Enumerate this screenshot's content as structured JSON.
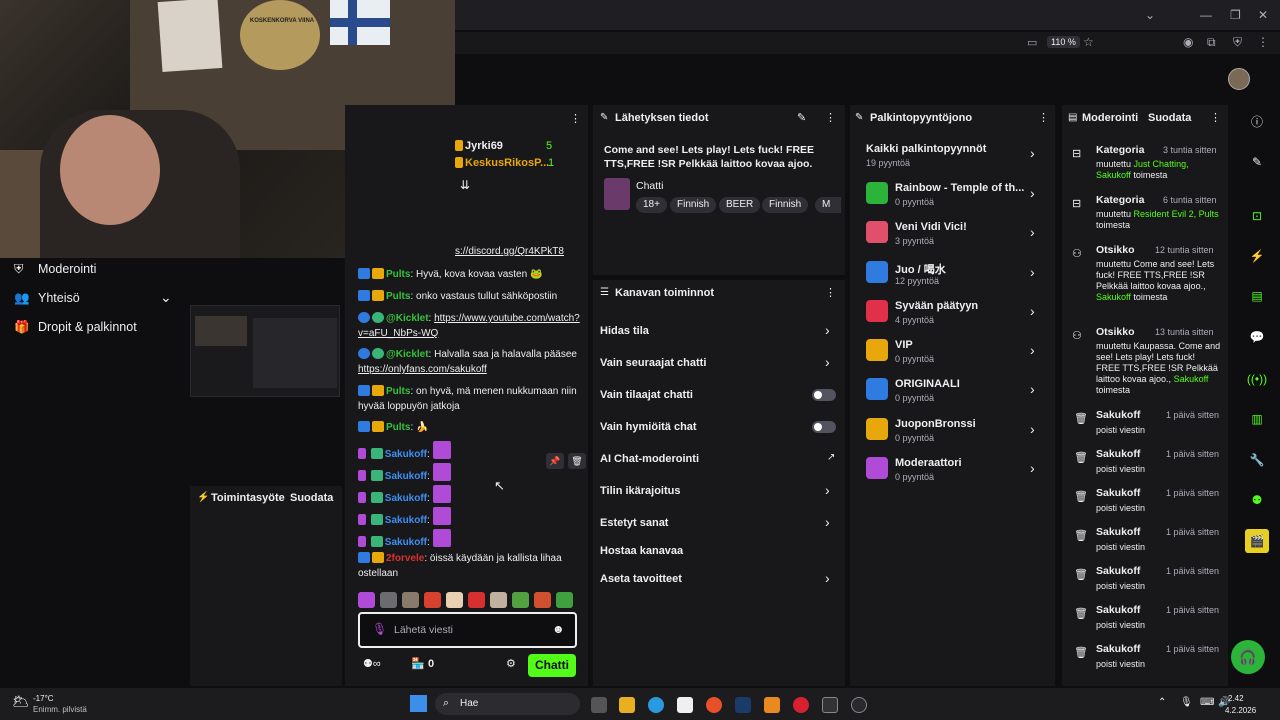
{
  "browser": {
    "zoom": "110 %"
  },
  "webcam": {
    "poster_text": "KOSKENKORVA VIINA"
  },
  "leftnav": {
    "items": [
      {
        "label": "Moderointi",
        "icon": "shield-icon"
      },
      {
        "label": "Yhteisö",
        "icon": "people-icon"
      },
      {
        "label": "Dropit & palkinnot",
        "icon": "gift-icon"
      }
    ]
  },
  "activity": {
    "title": "Toimintasyöte",
    "filter": "Suodata"
  },
  "chat": {
    "top_users": [
      {
        "name": "Jyrki69",
        "count": "5"
      },
      {
        "name": "KeskusRikosP...",
        "count": "1"
      }
    ],
    "pinned_link": "s://discord.gg/Qr4KPkT8",
    "messages": [
      {
        "user": "Pults",
        "text": "Hyvä, kova kovaa vasten"
      },
      {
        "user": "Pults",
        "text": "onko vastaus tullut sähköpostiin"
      },
      {
        "user": "@Kicklet",
        "text": "https://www.youtube.com/watch?v=aFU_NbPs-WQ"
      },
      {
        "user": "@Kicklet",
        "text": "Halvalla saa ja halavalla pääsee",
        "link": "https://onlyfans.com/sakukoff"
      },
      {
        "user": "Pults",
        "text": "on hyvä, mä menen nukkumaan niin hyvää loppuyön jatkoja"
      },
      {
        "user": "Pults",
        "text": ""
      },
      {
        "user": "Sakukoff",
        "text": ""
      },
      {
        "user": "Sakukoff",
        "text": ""
      },
      {
        "user": "Sakukoff",
        "text": ""
      },
      {
        "user": "Sakukoff",
        "text": ""
      },
      {
        "user": "Sakukoff",
        "text": ""
      },
      {
        "user": "2forvele",
        "text": "öissä käydään ja kallista lihaa ostellaan"
      }
    ],
    "input_placeholder": "Lähetä viesti",
    "points": "0",
    "send_label": "Chatti"
  },
  "stream_info": {
    "title": "Lähetyksen tiedot",
    "stream_title": "Come and see! Lets play! Lets fuck! FREE TTS,FREE !SR Pelkkää laittoo kovaa ajoo.",
    "category": "Chatti",
    "tags": [
      "18+",
      "Finnish",
      "BEER",
      "Finnish",
      "M"
    ]
  },
  "channel_actions": {
    "title": "Kanavan toiminnot",
    "items": [
      {
        "label": "Hidas tila",
        "control": "chevron"
      },
      {
        "label": "Vain seuraajat chatti",
        "control": "chevron"
      },
      {
        "label": "Vain tilaajat chatti",
        "control": "toggle"
      },
      {
        "label": "Vain hymiöitä chat",
        "control": "toggle"
      },
      {
        "label": "AI Chat-moderointi",
        "control": "external"
      },
      {
        "label": "Tilin ikärajoitus",
        "control": "chevron"
      },
      {
        "label": "Estetyt sanat",
        "control": "chevron"
      },
      {
        "label": "Hostaa kanavaa",
        "control": "none"
      },
      {
        "label": "Aseta tavoitteet",
        "control": "chevron"
      }
    ]
  },
  "rewards": {
    "title": "Palkintopyyntöjono",
    "all": {
      "label": "Kaikki palkintopyynnöt",
      "count": "19 pyyntöä"
    },
    "items": [
      {
        "name": "Rainbow - Temple of th...",
        "count": "0 pyyntöä",
        "color": "#2bb33a"
      },
      {
        "name": "Veni Vidi Vici!",
        "count": "3 pyyntöä",
        "color": "#e0506a"
      },
      {
        "name": "Juo / 喝水",
        "count": "12 pyyntöä",
        "color": "#2f7be0"
      },
      {
        "name": "Syvään päätyyn",
        "count": "4 pyyntöä",
        "color": "#e0304a"
      },
      {
        "name": "VIP",
        "count": "0 pyyntöä",
        "color": "#e8a80c"
      },
      {
        "name": "ORIGINAALI",
        "count": "0 pyyntöä",
        "color": "#2f7be0"
      },
      {
        "name": "JuoponBronssi",
        "count": "0 pyyntöä",
        "color": "#e8a80c"
      },
      {
        "name": "Moderaattori",
        "count": "0 pyyntöä",
        "color": "#b04bd8"
      }
    ]
  },
  "moderation": {
    "title": "Moderointi",
    "filter": "Suodata",
    "entries": [
      {
        "title": "Kategoria",
        "time": "3 tuntia sitten",
        "body": "muutettu",
        "highlight": "Just Chatting, Sakukoff",
        "suffix": "toimesta"
      },
      {
        "title": "Kategoria",
        "time": "6 tuntia sitten",
        "body": "muutettu",
        "highlight": "Resident Evil 2, Pults",
        "suffix": "toimesta"
      },
      {
        "title": "Otsikko",
        "time": "12 tuntia sitten",
        "body": "muutettu Come and see! Lets fuck! FREE TTS,FREE !SR Pelkkää laittoo kovaa ajoo.,",
        "highlight": "Sakukoff",
        "suffix": "toimesta"
      },
      {
        "title": "Otsikko",
        "time": "13 tuntia sitten",
        "body": "muutettu Kaupassa. Come and see! Lets play! Lets fuck! FREE TTS,FREE !SR Pelkkää laittoo kovaa ajoo.,",
        "highlight": "Sakukoff",
        "suffix": "toimesta"
      },
      {
        "title": "Sakukoff",
        "time": "1 päivä sitten",
        "body": "poisti viestin"
      },
      {
        "title": "Sakukoff",
        "time": "1 päivä sitten",
        "body": "poisti viestin"
      },
      {
        "title": "Sakukoff",
        "time": "1 päivä sitten",
        "body": "poisti viestin"
      },
      {
        "title": "Sakukoff",
        "time": "1 päivä sitten",
        "body": "poisti viestin"
      },
      {
        "title": "Sakukoff",
        "time": "1 päivä sitten",
        "body": "poisti viestin"
      },
      {
        "title": "Sakukoff",
        "time": "1 päivä sitten",
        "body": "poisti viestin"
      },
      {
        "title": "Sakukoff",
        "time": "1 päivä sitten",
        "body": "poisti viestin"
      }
    ]
  },
  "taskbar": {
    "weather_temp": "-17°C",
    "weather_desc": "Enimm. pilvistä",
    "search": "Hae",
    "time": "2.42",
    "date": "4.2.2026"
  }
}
